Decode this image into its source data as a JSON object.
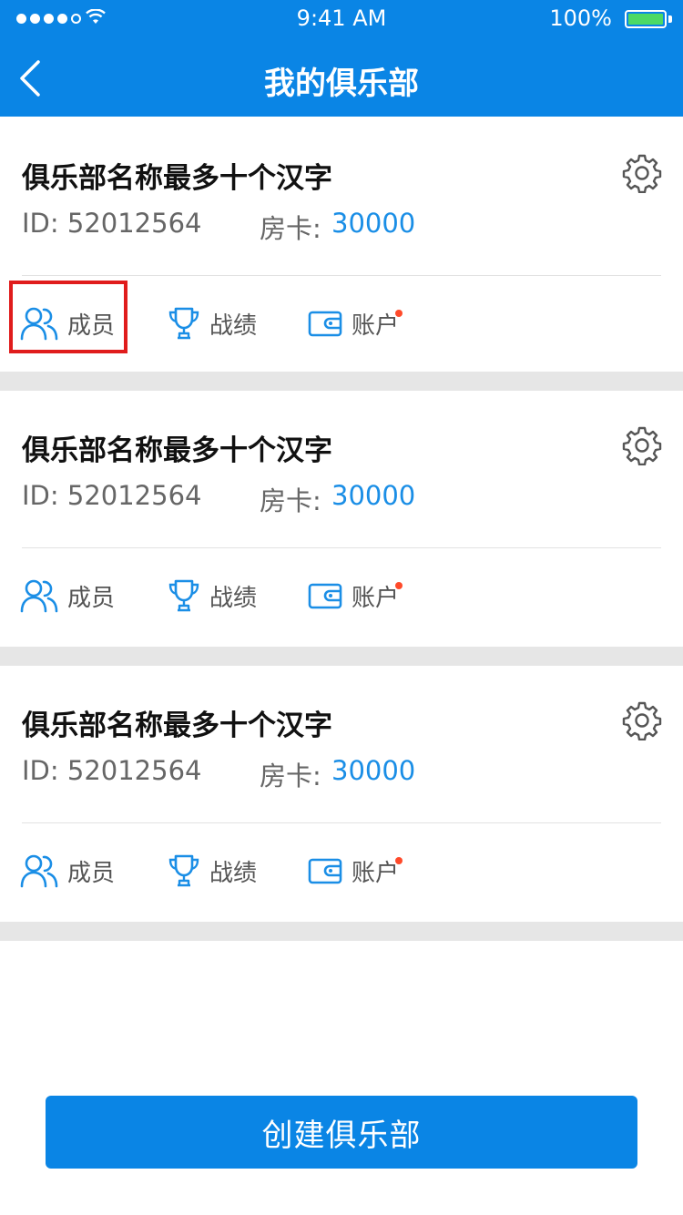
{
  "status_bar": {
    "time": "9:41 AM",
    "battery": "100%"
  },
  "nav": {
    "title": "我的俱乐部"
  },
  "clubs": [
    {
      "name": "俱乐部名称最多十个汉字",
      "id_text": "ID: 52012564",
      "card_label": "房卡:",
      "card_value": "30000",
      "actions": {
        "members": "成员",
        "records": "战绩",
        "account": "账户"
      }
    },
    {
      "name": "俱乐部名称最多十个汉字",
      "id_text": "ID: 52012564",
      "card_label": "房卡:",
      "card_value": "30000",
      "actions": {
        "members": "成员",
        "records": "战绩",
        "account": "账户"
      }
    },
    {
      "name": "俱乐部名称最多十个汉字",
      "id_text": "ID: 52012564",
      "card_label": "房卡:",
      "card_value": "30000",
      "actions": {
        "members": "成员",
        "records": "战绩",
        "account": "账户"
      }
    }
  ],
  "create_button": "创建俱乐部",
  "icons": [
    "back-chevron-icon",
    "wifi-icon",
    "battery-icon",
    "gear-icon",
    "members-icon",
    "trophy-icon",
    "wallet-icon"
  ],
  "colors": {
    "primary": "#0a85e5",
    "accent_value": "#1a8ee6",
    "notify_dot": "#ff4a2a",
    "highlight": "#e01c1c",
    "separator": "#e6e6e6"
  }
}
